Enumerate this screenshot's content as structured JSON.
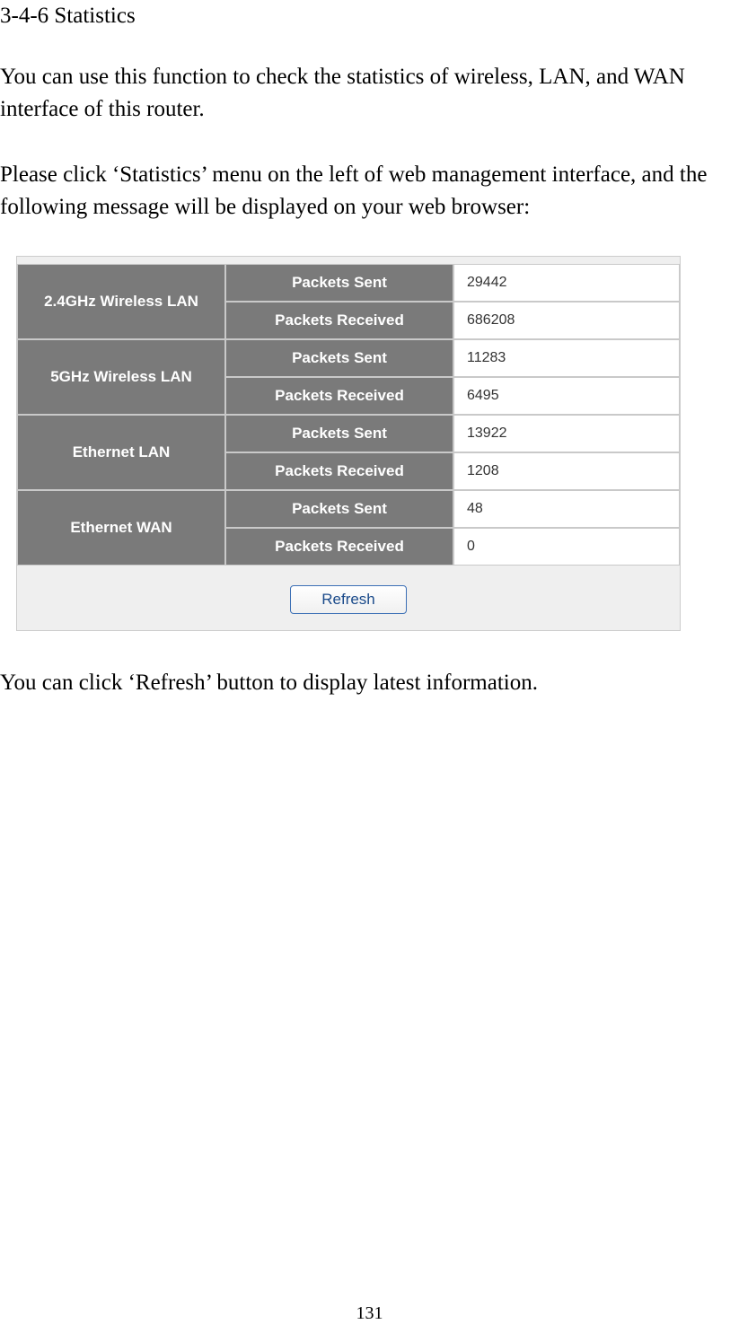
{
  "heading": "3-4-6 Statistics",
  "paragraphs": {
    "p1": "You can use this function to check the statistics of wireless, LAN, and WAN interface of this router.",
    "p2": "Please click ‘Statistics’ menu on the left of web management interface, and the following message will be displayed on your web browser:",
    "p3": "You can click ‘Refresh’ button to display latest information."
  },
  "stats": {
    "labels": {
      "packets_sent": "Packets Sent",
      "packets_received": "Packets Received"
    },
    "interfaces": [
      {
        "name": "2.4GHz Wireless LAN",
        "sent": "29442",
        "received": "686208"
      },
      {
        "name": "5GHz Wireless LAN",
        "sent": "11283",
        "received": "6495"
      },
      {
        "name": "Ethernet LAN",
        "sent": "13922",
        "received": "1208"
      },
      {
        "name": "Ethernet WAN",
        "sent": "48",
        "received": "0"
      }
    ],
    "refresh_label": "Refresh"
  },
  "page_number": "131"
}
